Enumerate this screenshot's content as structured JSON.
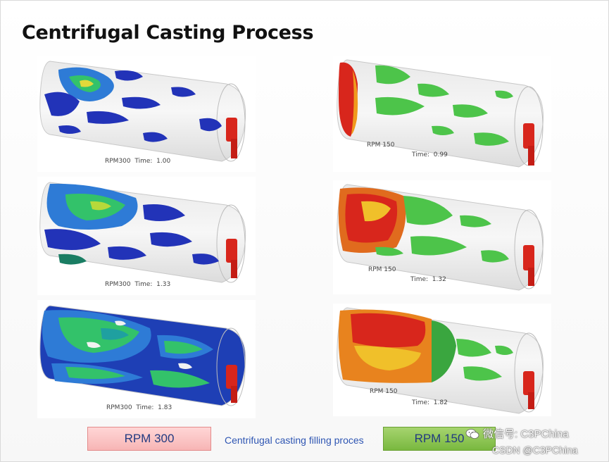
{
  "slide": {
    "title": "Centrifugal Casting Process",
    "panels": [
      {
        "caption": "RPM300  Time:  1.00"
      },
      {
        "caption": "RPM300  Time:  1.33"
      },
      {
        "caption": "RPM300  Time:  1.83"
      },
      {
        "caption_rpm": "RPM 150",
        "caption_time": "Time:  0.99"
      },
      {
        "caption_rpm": "RPM 150",
        "caption_time": "Time:  1.32"
      },
      {
        "caption_rpm": "RPM 150",
        "caption_time": "Time:  1.82"
      }
    ],
    "button_left": "RPM 300",
    "middle_caption": "Centrifugal casting filling proces",
    "button_right": "RPM 150"
  },
  "watermark": {
    "line1": "微信号: C3PChina",
    "line2": "CSDN @C3PChina"
  },
  "colors": {
    "rpm300_button": "#f7b5b5",
    "rpm150_button": "#79b83f",
    "caption_blue": "#2f56b3",
    "blue_fill": "#2233b8",
    "green_fill": "#4dc44a",
    "red_fill": "#d8261c"
  },
  "icons": {
    "watermark_logo": "wechat-icon"
  }
}
